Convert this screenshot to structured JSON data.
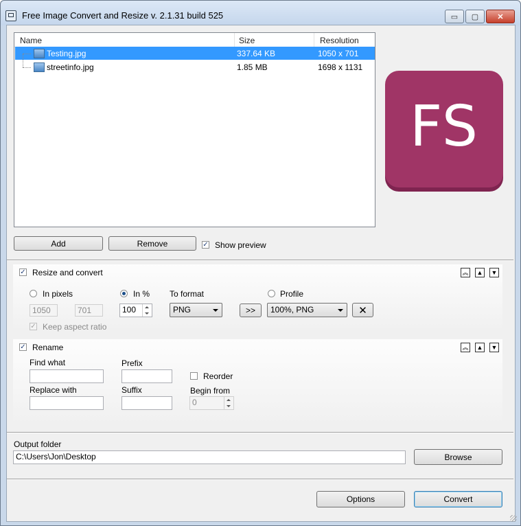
{
  "window": {
    "title": "Free Image Convert and Resize  v. 2.1.31 build 525",
    "controls": {
      "minimize": "▭",
      "maximize": "▢",
      "close": "✕"
    }
  },
  "file_list": {
    "columns": [
      "Name",
      "Size",
      "Resolution"
    ],
    "rows": [
      {
        "name": "Testing.jpg",
        "size": "337.64 KB",
        "resolution": "1050 x 701",
        "selected": true
      },
      {
        "name": "streetinfo.jpg",
        "size": "1.85 MB",
        "resolution": "1698 x 1131",
        "selected": false
      }
    ]
  },
  "logo": {
    "text": "FS",
    "color": "#a03566"
  },
  "list_buttons": {
    "add": "Add",
    "remove": "Remove"
  },
  "show_preview": {
    "label": "Show preview",
    "checked": true
  },
  "resize": {
    "header": "Resize and convert",
    "checked": true,
    "in_pixels_label": "In pixels",
    "width": "1050",
    "height": "701",
    "keep_aspect": "Keep aspect ratio",
    "in_percent_label": "In %",
    "percent": "100",
    "to_format_label": "To format",
    "format": "PNG",
    "apply_button": ">>",
    "profile_label": "Profile",
    "profile": "100%, PNG",
    "delete_icon": "✕",
    "panel_buttons": {
      "top": "︽",
      "up": "▲",
      "down": "▼"
    }
  },
  "rename": {
    "header": "Rename",
    "checked": true,
    "find_label": "Find what",
    "find_value": "",
    "prefix_label": "Prefix",
    "prefix_value": "",
    "reorder_label": "Reorder",
    "replace_label": "Replace with",
    "replace_value": "",
    "suffix_label": "Suffix",
    "suffix_value": "",
    "begin_label": "Begin from",
    "begin_value": "0",
    "panel_buttons": {
      "top": "︽",
      "up": "▲",
      "down": "▼"
    }
  },
  "output": {
    "label": "Output folder",
    "path": "C:\\Users\\Jon\\Desktop",
    "browse": "Browse"
  },
  "footer": {
    "options": "Options",
    "convert": "Convert"
  },
  "colors": {
    "selection": "#3399ff",
    "accent": "#a03566"
  }
}
